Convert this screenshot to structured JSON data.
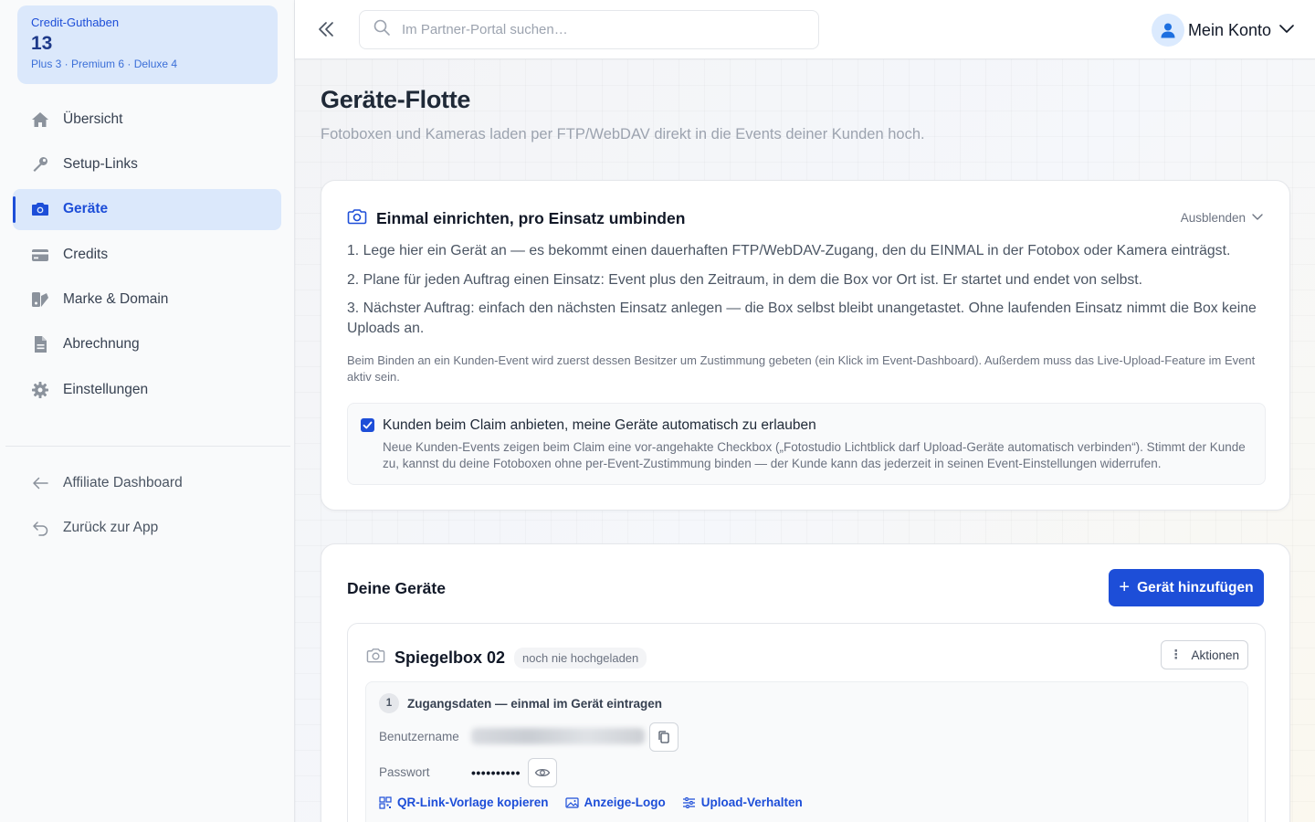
{
  "credits": {
    "label": "Credit-Guthaben",
    "value": "13",
    "breakdown": "Plus 3 · Premium 6 · Deluxe 4"
  },
  "sidebar": {
    "items": [
      {
        "label": "Übersicht",
        "icon": "home-icon"
      },
      {
        "label": "Setup-Links",
        "icon": "wrench-icon"
      },
      {
        "label": "Geräte",
        "icon": "camera-icon",
        "active": true
      },
      {
        "label": "Credits",
        "icon": "credit-card-icon"
      },
      {
        "label": "Marke & Domain",
        "icon": "brand-icon"
      },
      {
        "label": "Abrechnung",
        "icon": "document-icon"
      },
      {
        "label": "Einstellungen",
        "icon": "gear-icon"
      }
    ],
    "secondary": [
      {
        "label": "Affiliate Dashboard",
        "icon": "arrow-left-icon"
      },
      {
        "label": "Zurück zur App",
        "icon": "return-icon"
      }
    ]
  },
  "topbar": {
    "search_placeholder": "Im Partner-Portal suchen…",
    "account_label": "Mein Konto"
  },
  "page": {
    "title": "Geräte-Flotte",
    "subtitle": "Fotoboxen und Kameras laden per FTP/WebDAV direkt in die Events deiner Kunden hoch."
  },
  "info_card": {
    "title": "Einmal einrichten, pro Einsatz umbinden",
    "hide_label": "Ausblenden",
    "steps": [
      "1. Lege hier ein Gerät an — es bekommt einen dauerhaften FTP/WebDAV-Zugang, den du EINMAL in der Fotobox oder Kamera einträgst.",
      "2. Plane für jeden Auftrag einen Einsatz: Event plus den Zeitraum, in dem die Box vor Ort ist. Er startet und endet von selbst.",
      "3. Nächster Auftrag: einfach den nächsten Einsatz anlegen — die Box selbst bleibt unangetastet. Ohne laufenden Einsatz nimmt die Box keine Uploads an."
    ],
    "note": "Beim Binden an ein Kunden-Event wird zuerst dessen Besitzer um Zustimmung gebeten (ein Klick im Event-Dashboard). Außerdem muss das Live-Upload-Feature im Event aktiv sein.",
    "option": {
      "checked": true,
      "title": "Kunden beim Claim anbieten, meine Geräte automatisch zu erlauben",
      "description": "Neue Kunden-Events zeigen beim Claim eine vor-angehakte Checkbox („Fotostudio Lichtblick darf Upload-Geräte automatisch verbinden“). Stimmt der Kunde zu, kannst du deine Fotoboxen ohne per-Event-Zustimmung binden — der Kunde kann das jederzeit in seinen Event-Einstellungen widerrufen."
    }
  },
  "devices_card": {
    "title": "Deine Geräte",
    "add_label": "Gerät hinzufügen",
    "device": {
      "name": "Spiegelbox 02",
      "status": "noch nie hochgeladen",
      "actions_label": "Aktionen",
      "access": {
        "step": "1",
        "title": "Zugangsdaten — einmal im Gerät eintragen",
        "username_label": "Benutzername",
        "password_label": "Passwort",
        "password_masked": "••••••••••"
      },
      "links": [
        {
          "label": "QR-Link-Vorlage kopieren",
          "icon": "qr-icon"
        },
        {
          "label": "Anzeige-Logo",
          "icon": "image-icon"
        },
        {
          "label": "Upload-Verhalten",
          "icon": "sliders-icon"
        }
      ]
    }
  },
  "colors": {
    "accent": "#1d4ed8",
    "accent_soft": "#dbe8fb"
  }
}
